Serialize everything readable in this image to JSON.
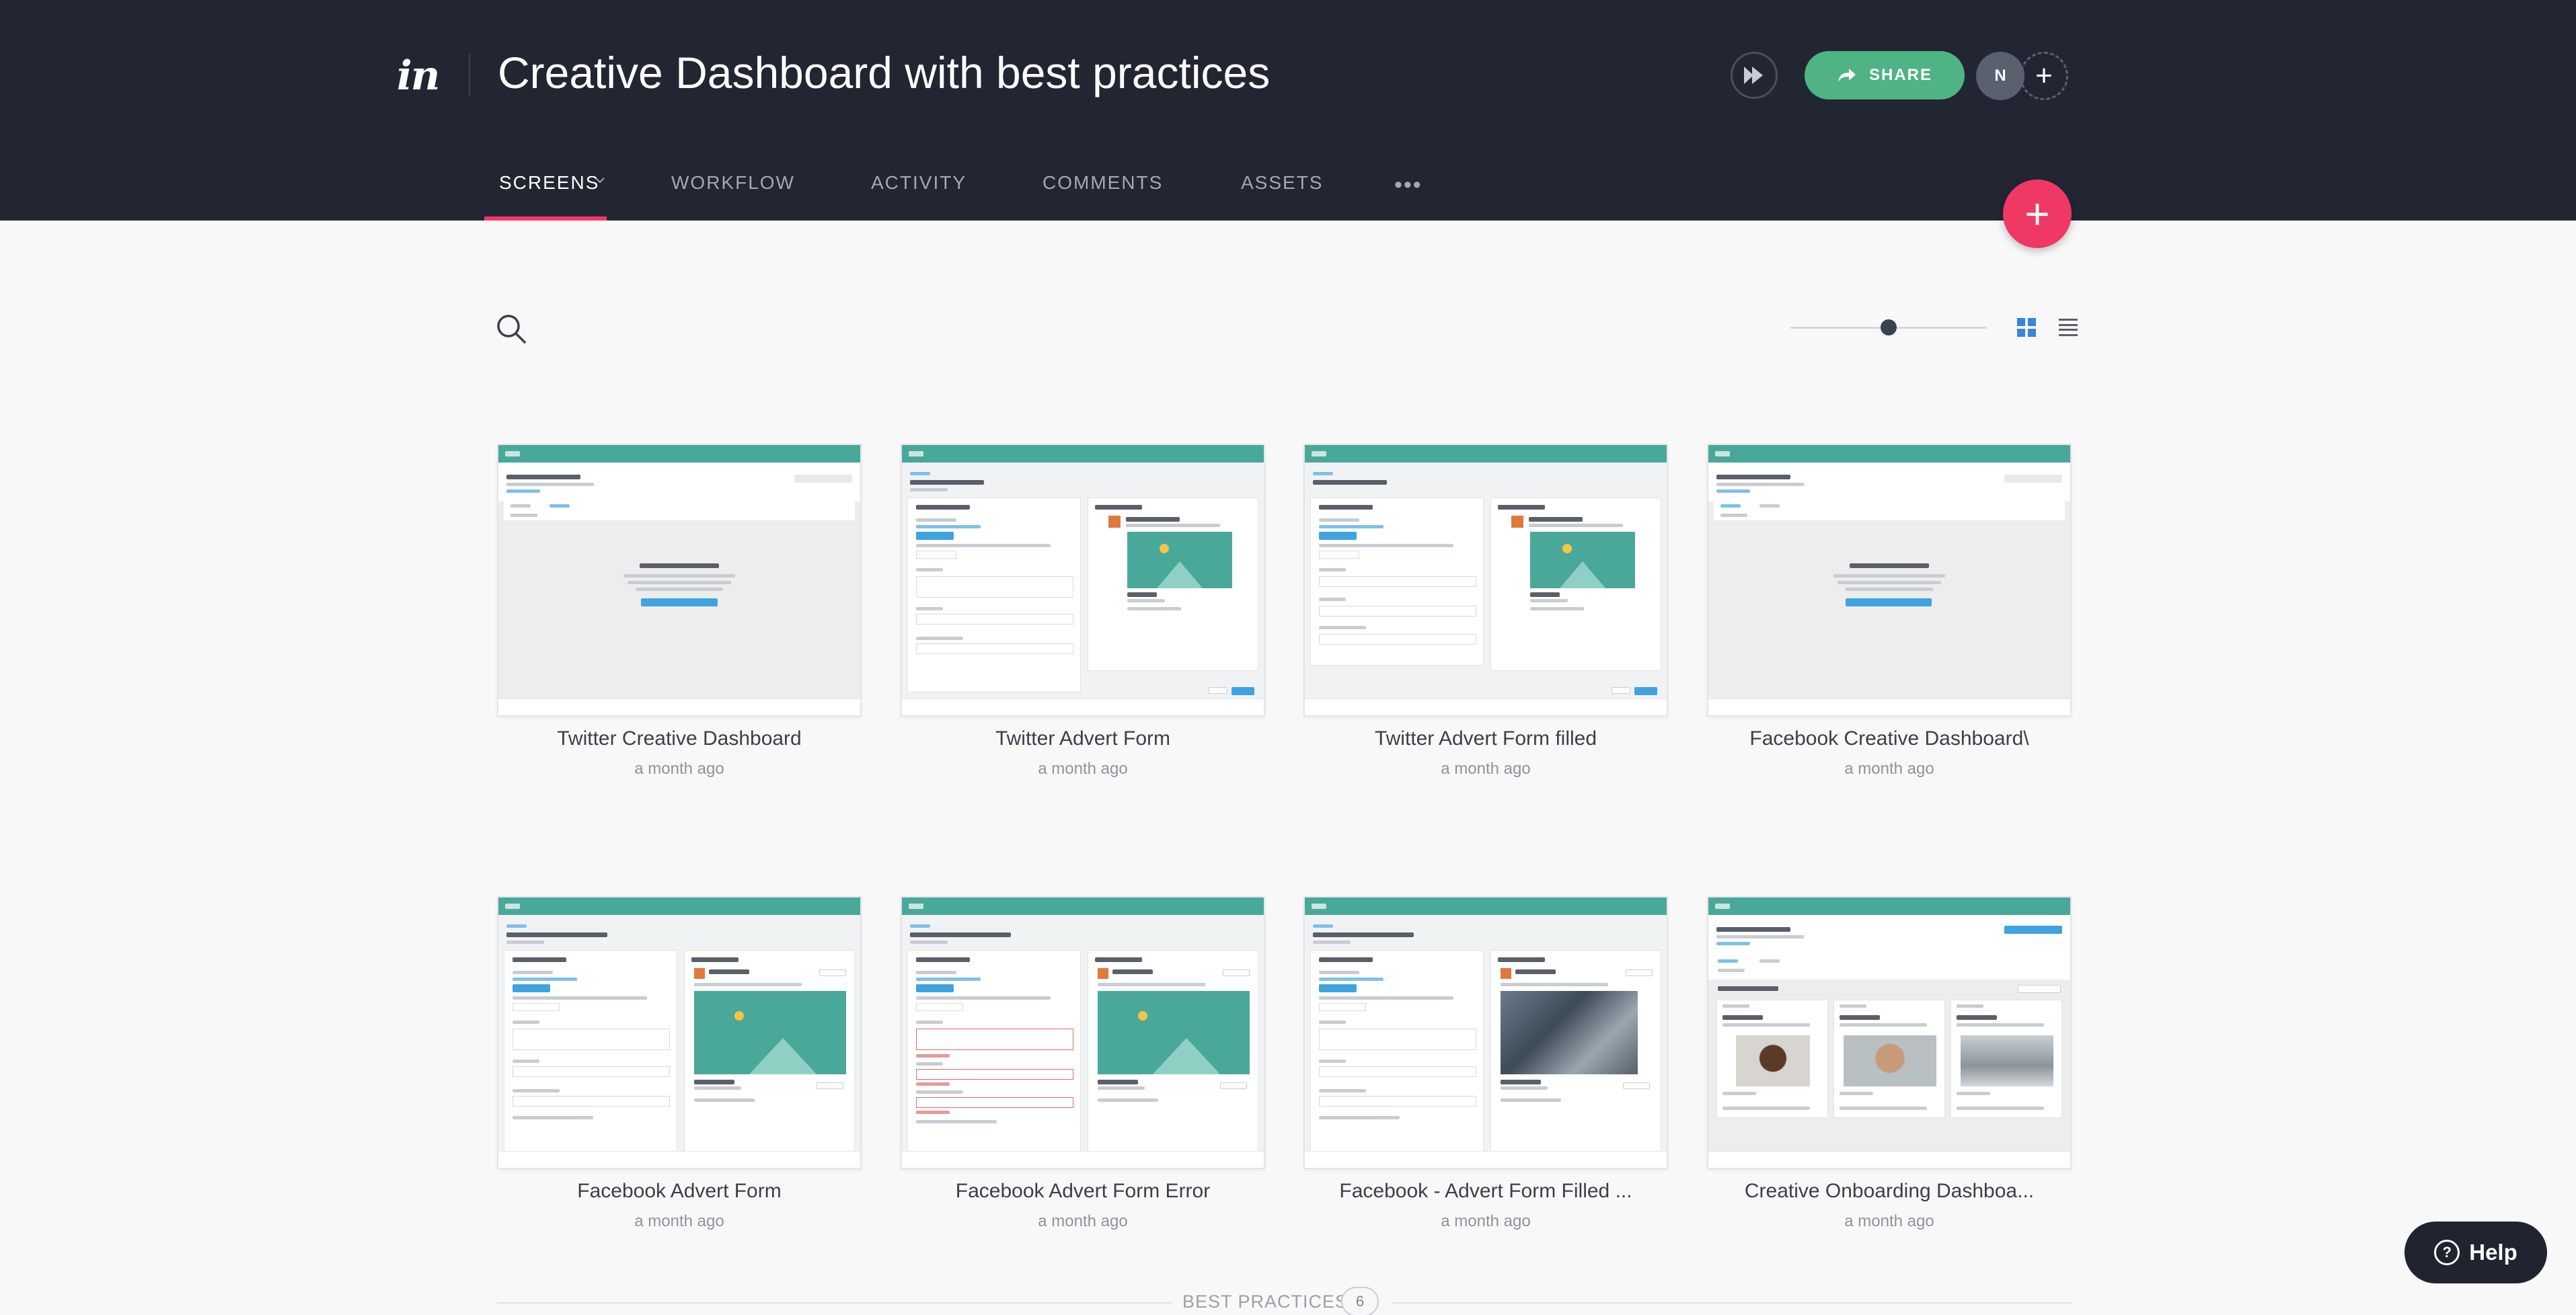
{
  "header": {
    "logo": "in",
    "project_title": "Creative Dashboard with best practices",
    "share_label": "SHARE",
    "avatar_initial": "N",
    "add_symbol": "+"
  },
  "tabs": [
    {
      "label": "SCREENS",
      "active": true
    },
    {
      "label": "WORKFLOW"
    },
    {
      "label": "ACTIVITY"
    },
    {
      "label": "COMMENTS"
    },
    {
      "label": "ASSETS"
    }
  ],
  "more_label": "•••",
  "fab_symbol": "+",
  "toolbar": {
    "zoom_level_fraction": 0.5,
    "view_mode": "grid"
  },
  "screens": [
    {
      "title": "Twitter Creative Dashboard",
      "time": "a month ago"
    },
    {
      "title": "Twitter Advert Form",
      "time": "a month ago"
    },
    {
      "title": "Twitter Advert Form filled",
      "time": "a month ago"
    },
    {
      "title": "Facebook Creative Dashboard\\",
      "time": "a month ago"
    },
    {
      "title": "Facebook Advert Form",
      "time": "a month ago"
    },
    {
      "title": "Facebook Advert Form Error",
      "time": "a month ago"
    },
    {
      "title": "Facebook - Advert Form Filled ...",
      "time": "a month ago"
    },
    {
      "title": "Creative Onboarding Dashboa...",
      "time": "a month ago"
    }
  ],
  "section": {
    "label": "BEST PRACTICES",
    "count": "6"
  },
  "help_label": "Help",
  "colors": {
    "header_bg": "#222632",
    "accent_pink": "#ef3864",
    "share_green": "#4fb384",
    "thumb_teal": "#4aa89a"
  }
}
